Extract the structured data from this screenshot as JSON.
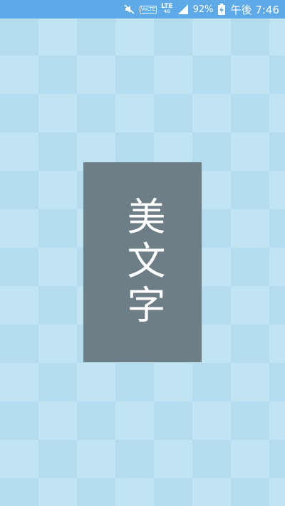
{
  "status_bar": {
    "icons": [
      "mute-icon",
      "volte-icon",
      "lte-icon",
      "signal-icon",
      "battery-charging-icon"
    ],
    "volte_label": "VoLTE",
    "lte_label": "LTE",
    "lte_sub": "4G",
    "battery_percent": "92%",
    "time": "午後 7:46",
    "background_color": "#5ea9e8"
  },
  "card": {
    "title": "美文字",
    "background_color": "#6e7e87"
  },
  "background": {
    "pattern": "checkerboard",
    "colors": [
      "#b3dcee",
      "#c1e4f3"
    ]
  }
}
